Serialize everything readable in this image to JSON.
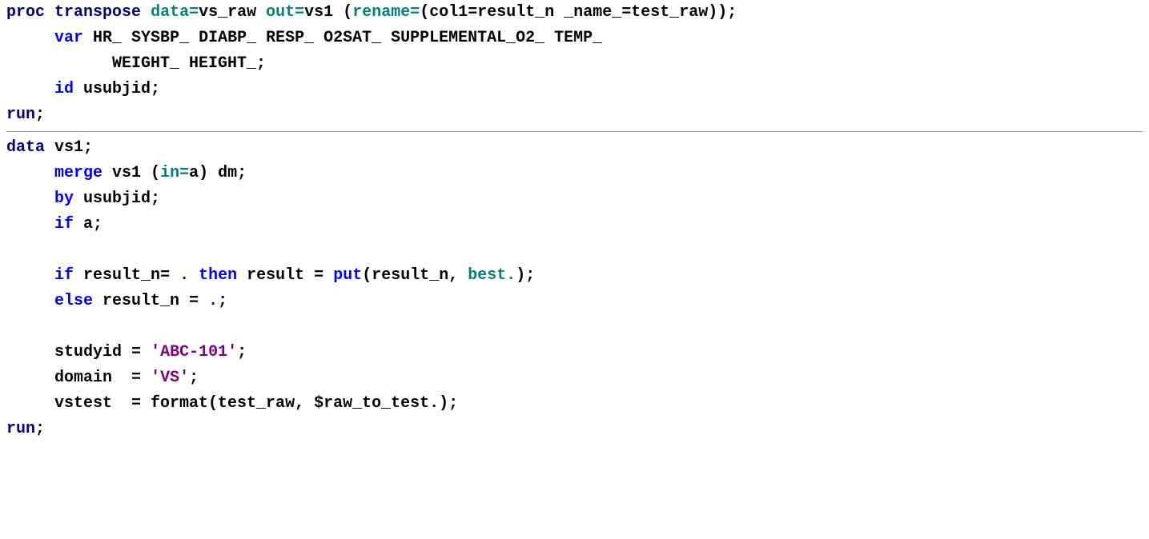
{
  "code": {
    "block1": {
      "l1": {
        "proc": "proc",
        "transpose": "transpose",
        "data_opt": "data=",
        "data_val": "vs_raw",
        "out_opt": "out=",
        "out_val": "vs1",
        "rename_opt": "rename=",
        "rename_val": "(col1=result_n _name_=test_raw));",
        "rename_open": "("
      },
      "l2": {
        "var": "var",
        "vars": "HR_ SYSBP_ DIABP_ RESP_ O2SAT_ SUPPLEMENTAL_O2_ TEMP_"
      },
      "l3": {
        "vars": "WEIGHT_ HEIGHT_;"
      },
      "l4": {
        "id": "id",
        "val": "usubjid;"
      },
      "l5": {
        "run": "run",
        "semi": ";"
      }
    },
    "block2": {
      "l1": {
        "data": "data",
        "name": "vs1;"
      },
      "l2": {
        "merge": "merge",
        "rest": "vs1 (",
        "in_opt": "in=",
        "in_val": "a) dm;"
      },
      "l3": {
        "by": "by",
        "val": "usubjid;"
      },
      "l4": {
        "if": "if",
        "val": "a;"
      },
      "l5": {
        "if": "if",
        "cond": "result_n=",
        "dot": ".",
        "then": "then",
        "assign": "result =",
        "put": "put",
        "args_open": "(result_n,",
        "best": "best.",
        "args_close": ");"
      },
      "l6": {
        "else": "else",
        "assign": "result_n =",
        "dot": ".",
        "semi": ";"
      },
      "l7": {
        "lhs": "studyid =",
        "str": "'ABC-101'",
        "semi": ";"
      },
      "l8": {
        "lhs": "domain  =",
        "str": "'VS'",
        "semi": ";"
      },
      "l9": {
        "lhs": "vstest  = format(test_raw, $raw_to_test.);"
      },
      "l10": {
        "run": "run",
        "semi": ";"
      }
    }
  }
}
